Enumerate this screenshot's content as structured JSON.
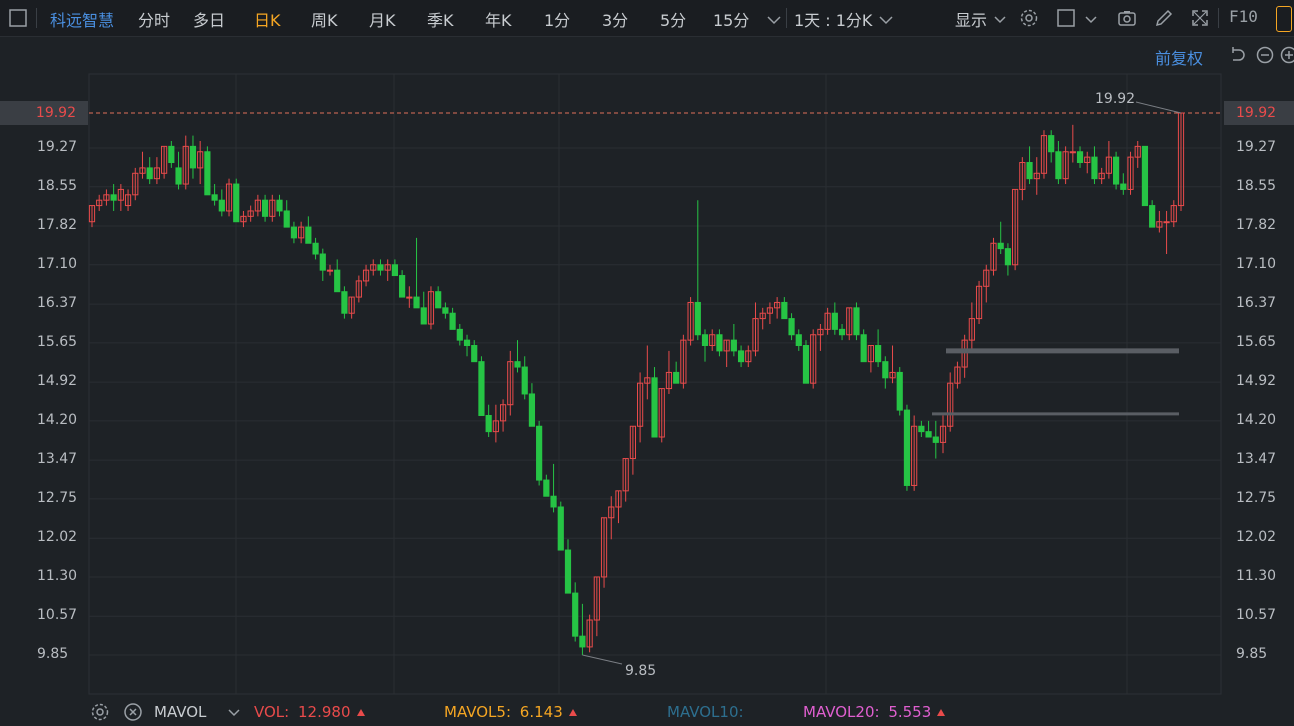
{
  "toolbar": {
    "stock_name": "科远智慧",
    "periods": [
      "分时",
      "多日",
      "日K",
      "周K",
      "月K",
      "季K",
      "年K",
      "1分",
      "3分",
      "5分",
      "15分"
    ],
    "active_period": "日K",
    "interval_select": "1天 : 1分K",
    "display_label": "显示",
    "f10_label": "F10"
  },
  "subbar": {
    "fuquan_label": "前复权"
  },
  "axis": {
    "price_labels": [
      "19.92",
      "19.27",
      "18.55",
      "17.82",
      "17.10",
      "16.37",
      "15.65",
      "14.92",
      "14.20",
      "13.47",
      "12.75",
      "12.02",
      "11.30",
      "10.57",
      "9.85"
    ],
    "current_price": "19.92",
    "high_label": "19.92",
    "low_label": "9.85"
  },
  "chart_data": {
    "type": "candlestick",
    "ylim": [
      9.85,
      19.92
    ],
    "current_price": 19.92,
    "high": 19.92,
    "low": 9.85,
    "candles": [
      [
        17.9,
        18.2,
        17.8,
        18.2
      ],
      [
        18.2,
        18.4,
        18.1,
        18.3
      ],
      [
        18.3,
        18.5,
        18.2,
        18.4
      ],
      [
        18.4,
        18.6,
        18.1,
        18.3
      ],
      [
        18.3,
        18.6,
        18.1,
        18.5
      ],
      [
        18.2,
        18.5,
        18.1,
        18.4
      ],
      [
        18.4,
        18.9,
        18.3,
        18.8
      ],
      [
        18.8,
        19.2,
        18.7,
        18.9
      ],
      [
        18.9,
        19.1,
        18.6,
        18.7
      ],
      [
        18.7,
        19.1,
        18.6,
        18.9
      ],
      [
        18.8,
        19.3,
        18.7,
        19.3
      ],
      [
        19.3,
        19.4,
        18.9,
        19.0
      ],
      [
        18.9,
        19.2,
        18.5,
        18.6
      ],
      [
        18.6,
        19.5,
        18.5,
        19.3
      ],
      [
        19.3,
        19.5,
        18.7,
        18.9
      ],
      [
        18.9,
        19.4,
        18.6,
        19.2
      ],
      [
        19.2,
        19.3,
        18.4,
        18.4
      ],
      [
        18.4,
        18.6,
        18.2,
        18.3
      ],
      [
        18.3,
        18.5,
        18.0,
        18.1
      ],
      [
        18.1,
        18.7,
        18.0,
        18.6
      ],
      [
        18.6,
        18.7,
        17.9,
        17.9
      ],
      [
        17.9,
        18.1,
        17.8,
        18.0
      ],
      [
        18.0,
        18.2,
        17.9,
        18.1
      ],
      [
        18.1,
        18.4,
        18.0,
        18.3
      ],
      [
        18.3,
        18.4,
        17.9,
        18.0
      ],
      [
        18.0,
        18.4,
        17.9,
        18.3
      ],
      [
        18.3,
        18.4,
        18.0,
        18.1
      ],
      [
        18.1,
        18.3,
        17.8,
        17.8
      ],
      [
        17.8,
        17.9,
        17.5,
        17.6
      ],
      [
        17.6,
        17.9,
        17.5,
        17.8
      ],
      [
        17.8,
        18.0,
        17.5,
        17.5
      ],
      [
        17.5,
        17.6,
        17.2,
        17.3
      ],
      [
        17.3,
        17.4,
        16.8,
        17.0
      ],
      [
        17.0,
        17.1,
        16.9,
        17.0
      ],
      [
        17.0,
        17.2,
        16.6,
        16.6
      ],
      [
        16.6,
        16.7,
        16.1,
        16.2
      ],
      [
        16.2,
        16.5,
        16.1,
        16.5
      ],
      [
        16.5,
        16.9,
        16.4,
        16.8
      ],
      [
        16.8,
        17.1,
        16.7,
        17.0
      ],
      [
        17.0,
        17.2,
        16.9,
        17.1
      ],
      [
        17.1,
        17.2,
        16.9,
        17.0
      ],
      [
        17.0,
        17.2,
        16.8,
        17.1
      ],
      [
        17.1,
        17.2,
        16.9,
        16.9
      ],
      [
        16.9,
        17.0,
        16.5,
        16.5
      ],
      [
        16.5,
        16.7,
        16.3,
        16.5
      ],
      [
        16.5,
        17.6,
        16.4,
        16.3
      ],
      [
        16.3,
        16.6,
        16.0,
        16.0
      ],
      [
        16.0,
        16.7,
        15.9,
        16.6
      ],
      [
        16.6,
        16.7,
        16.3,
        16.3
      ],
      [
        16.3,
        16.4,
        16.1,
        16.2
      ],
      [
        16.2,
        16.3,
        15.9,
        15.9
      ],
      [
        15.9,
        16.0,
        15.6,
        15.7
      ],
      [
        15.7,
        15.8,
        15.4,
        15.6
      ],
      [
        15.6,
        15.7,
        15.3,
        15.3
      ],
      [
        15.3,
        15.4,
        14.3,
        14.3
      ],
      [
        14.3,
        14.5,
        13.9,
        14.0
      ],
      [
        14.0,
        14.5,
        13.8,
        14.2
      ],
      [
        14.2,
        14.6,
        14.0,
        14.5
      ],
      [
        14.5,
        15.5,
        14.3,
        15.3
      ],
      [
        15.3,
        15.7,
        15.1,
        15.2
      ],
      [
        15.2,
        15.4,
        14.6,
        14.7
      ],
      [
        14.7,
        14.9,
        14.1,
        14.1
      ],
      [
        14.1,
        14.2,
        13.0,
        13.1
      ],
      [
        13.1,
        13.2,
        12.8,
        12.8
      ],
      [
        12.8,
        13.4,
        12.5,
        12.6
      ],
      [
        12.6,
        12.7,
        11.8,
        11.8
      ],
      [
        11.8,
        12.0,
        11.0,
        11.0
      ],
      [
        11.0,
        11.2,
        10.1,
        10.2
      ],
      [
        10.2,
        10.8,
        9.85,
        10.0
      ],
      [
        10.0,
        10.6,
        9.9,
        10.5
      ],
      [
        10.5,
        11.3,
        10.2,
        11.3
      ],
      [
        11.3,
        12.4,
        11.1,
        12.4
      ],
      [
        12.4,
        12.8,
        12.0,
        12.6
      ],
      [
        12.6,
        12.9,
        12.3,
        12.9
      ],
      [
        12.9,
        13.5,
        12.7,
        13.5
      ],
      [
        13.5,
        14.1,
        13.2,
        14.1
      ],
      [
        14.1,
        15.1,
        13.8,
        14.9
      ],
      [
        14.9,
        15.6,
        14.6,
        15.0
      ],
      [
        15.0,
        15.2,
        13.9,
        13.9
      ],
      [
        13.9,
        14.8,
        13.8,
        14.8
      ],
      [
        14.8,
        15.5,
        14.7,
        15.1
      ],
      [
        15.1,
        15.3,
        14.9,
        14.9
      ],
      [
        14.9,
        15.8,
        14.8,
        15.7
      ],
      [
        15.7,
        16.5,
        15.6,
        16.4
      ],
      [
        16.4,
        18.3,
        15.7,
        15.8
      ],
      [
        15.8,
        15.9,
        15.3,
        15.6
      ],
      [
        15.6,
        15.9,
        15.5,
        15.8
      ],
      [
        15.8,
        15.9,
        15.4,
        15.5
      ],
      [
        15.5,
        15.7,
        15.2,
        15.7
      ],
      [
        15.7,
        16.0,
        15.4,
        15.5
      ],
      [
        15.5,
        15.6,
        15.2,
        15.3
      ],
      [
        15.3,
        15.6,
        15.2,
        15.5
      ],
      [
        15.5,
        16.4,
        15.4,
        16.1
      ],
      [
        16.1,
        16.3,
        15.9,
        16.2
      ],
      [
        16.2,
        16.4,
        16.0,
        16.3
      ],
      [
        16.3,
        16.5,
        16.1,
        16.4
      ],
      [
        16.4,
        16.5,
        16.1,
        16.1
      ],
      [
        16.1,
        16.2,
        15.7,
        15.8
      ],
      [
        15.8,
        15.9,
        15.5,
        15.6
      ],
      [
        15.6,
        15.7,
        14.9,
        14.9
      ],
      [
        14.9,
        15.9,
        14.8,
        15.8
      ],
      [
        15.8,
        16.0,
        15.5,
        15.9
      ],
      [
        15.9,
        16.3,
        15.8,
        16.2
      ],
      [
        16.2,
        16.4,
        15.8,
        15.9
      ],
      [
        15.9,
        16.0,
        15.7,
        15.8
      ],
      [
        15.8,
        16.3,
        15.7,
        16.3
      ],
      [
        16.3,
        16.4,
        15.7,
        15.8
      ],
      [
        15.8,
        15.9,
        15.3,
        15.3
      ],
      [
        15.3,
        15.6,
        15.1,
        15.6
      ],
      [
        15.6,
        15.9,
        15.2,
        15.3
      ],
      [
        15.3,
        15.4,
        14.8,
        15.0
      ],
      [
        15.0,
        15.6,
        14.9,
        15.1
      ],
      [
        15.1,
        15.2,
        14.3,
        14.4
      ],
      [
        14.4,
        14.5,
        12.9,
        13.0
      ],
      [
        13.0,
        14.3,
        12.9,
        14.1
      ],
      [
        14.1,
        14.2,
        13.9,
        14.0
      ],
      [
        14.0,
        14.2,
        13.9,
        13.9
      ],
      [
        13.9,
        14.2,
        13.5,
        13.8
      ],
      [
        13.8,
        14.3,
        13.6,
        14.1
      ],
      [
        14.1,
        15.1,
        14.0,
        14.9
      ],
      [
        14.9,
        15.3,
        14.8,
        15.2
      ],
      [
        15.2,
        15.8,
        15.0,
        15.7
      ],
      [
        15.7,
        16.4,
        15.5,
        16.1
      ],
      [
        16.1,
        16.8,
        16.0,
        16.7
      ],
      [
        16.7,
        17.1,
        16.4,
        17.0
      ],
      [
        17.0,
        17.6,
        16.9,
        17.5
      ],
      [
        17.5,
        17.9,
        17.3,
        17.4
      ],
      [
        17.4,
        17.5,
        16.9,
        17.1
      ],
      [
        17.1,
        18.5,
        17.0,
        18.5
      ],
      [
        18.5,
        19.1,
        18.3,
        19.0
      ],
      [
        19.0,
        19.3,
        18.6,
        18.7
      ],
      [
        18.7,
        19.1,
        18.4,
        18.8
      ],
      [
        18.8,
        19.6,
        18.7,
        19.5
      ],
      [
        19.5,
        19.6,
        19.0,
        19.2
      ],
      [
        19.2,
        19.4,
        18.6,
        18.7
      ],
      [
        18.7,
        19.3,
        18.6,
        19.2
      ],
      [
        19.2,
        19.7,
        19.0,
        19.2
      ],
      [
        19.2,
        19.3,
        18.9,
        19.0
      ],
      [
        19.0,
        19.2,
        18.8,
        19.1
      ],
      [
        19.1,
        19.3,
        18.6,
        18.7
      ],
      [
        18.7,
        18.9,
        18.6,
        18.8
      ],
      [
        18.8,
        19.4,
        18.7,
        19.1
      ],
      [
        19.1,
        19.2,
        18.5,
        18.6
      ],
      [
        18.6,
        18.8,
        18.4,
        18.5
      ],
      [
        18.5,
        19.2,
        18.4,
        19.1
      ],
      [
        19.1,
        19.4,
        18.9,
        19.3
      ],
      [
        19.3,
        19.3,
        18.2,
        18.2
      ],
      [
        18.2,
        18.3,
        17.8,
        17.8
      ],
      [
        17.8,
        18.1,
        17.7,
        17.9
      ],
      [
        17.9,
        18.1,
        17.3,
        17.9
      ],
      [
        17.9,
        18.3,
        17.8,
        18.2
      ],
      [
        18.2,
        19.92,
        18.1,
        19.92
      ]
    ]
  },
  "bottom": {
    "mavol_label": "MAVOL",
    "vol_key": "VOL:",
    "vol_value": "12.980",
    "mavol5_key": "MAVOL5:",
    "mavol5_value": "6.143",
    "mavol10_key": "MAVOL10:",
    "mavol20_key": "MAVOL20:",
    "mavol20_value": "5.553"
  },
  "colors": {
    "up": "#e94b4b",
    "down": "#26c445",
    "accent_blue": "#4a8fe0",
    "accent_orange": "#f5a623"
  }
}
